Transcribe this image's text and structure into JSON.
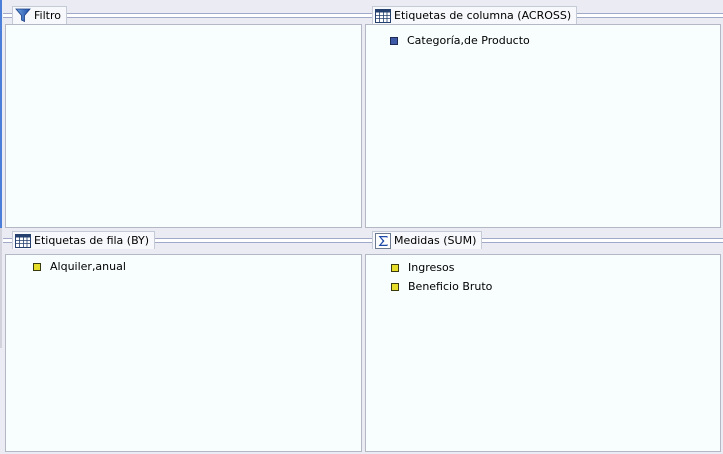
{
  "panes": {
    "filter": {
      "title": "Filtro",
      "icon": "funnel-icon",
      "items": []
    },
    "columns": {
      "title": "Etiquetas de columna (ACROSS)",
      "icon": "grid-icon",
      "items": [
        {
          "label": "Categoría,de Producto",
          "bullet": "blue"
        }
      ]
    },
    "rows": {
      "title": "Etiquetas de fila (BY)",
      "icon": "grid-icon",
      "items": [
        {
          "label": "Alquiler,anual",
          "bullet": "yellow"
        }
      ]
    },
    "measures": {
      "title": "Medidas (SUM)",
      "icon": "sigma-icon",
      "items": [
        {
          "label": "Ingresos",
          "bullet": "yellow"
        },
        {
          "label": "Beneficio Bruto",
          "bullet": "yellow"
        }
      ]
    }
  },
  "colors": {
    "pane_background": "#f8fefe",
    "header_line": "#a0aac8",
    "measure_bullet": "#e6dc2a",
    "dimension_bullet": "#3e5aa6",
    "accent_edge": "#4a7ed9"
  }
}
